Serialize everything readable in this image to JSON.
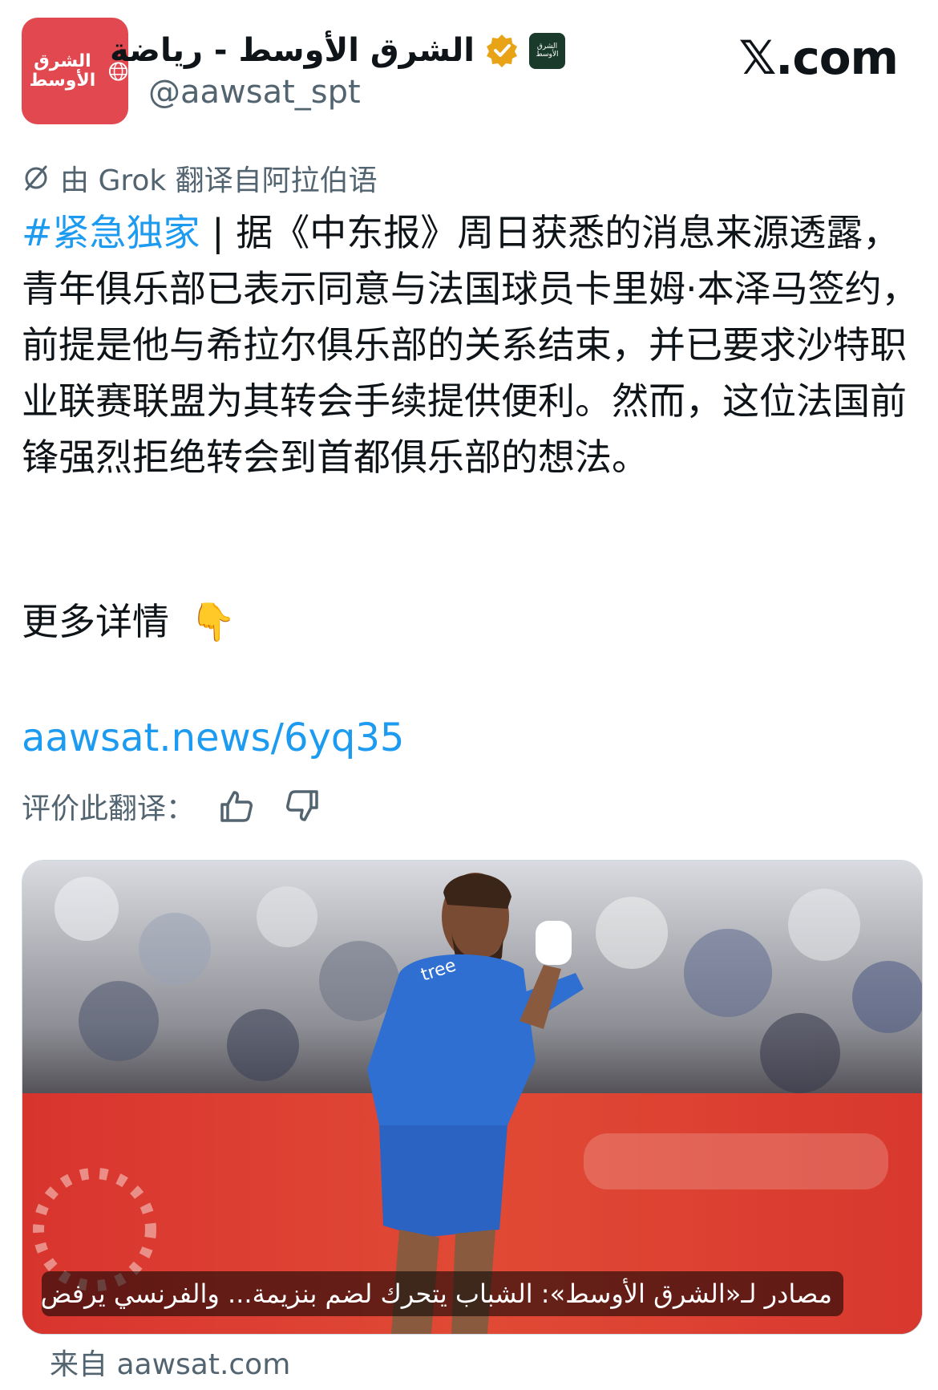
{
  "header": {
    "avatar_text": "الشرق الأوسط",
    "display_name": "الشرق الأوسط - رياضة",
    "mini_logo_text": "الشرق الأوسط",
    "handle": "@aawsat_spt",
    "site_logo": "𝕏.com"
  },
  "translation": {
    "label": "由 Grok 翻译自阿拉伯语"
  },
  "tweet": {
    "hashtag": "#紧急独家",
    "body": " | 据《中东报》周日获悉的消息来源透露，青年俱乐部已表示同意与法国球员卡里姆·本泽马签约，前提是他与希拉尔俱乐部的关系结束，并已要求沙特职业联赛联盟为其转会手续提供便利。然而，这位法国前锋强烈拒绝转会到首都俱乐部的想法。",
    "more_label": "更多详情",
    "more_emoji": "👇",
    "link": "aawsat.news/6yq35"
  },
  "rating": {
    "label": "评价此翻译："
  },
  "card": {
    "caption": "مصادر لـ«الشرق الأوسط»: الشباب يتحرك لضم بنزيمة... والفرنسي يرفض",
    "source": "来自 aawsat.com"
  },
  "colors": {
    "accent": "#1d9bf0",
    "muted": "#536471",
    "text": "#0f1419",
    "avatar_bg": "#e1484f",
    "verified": "#e8a317"
  }
}
